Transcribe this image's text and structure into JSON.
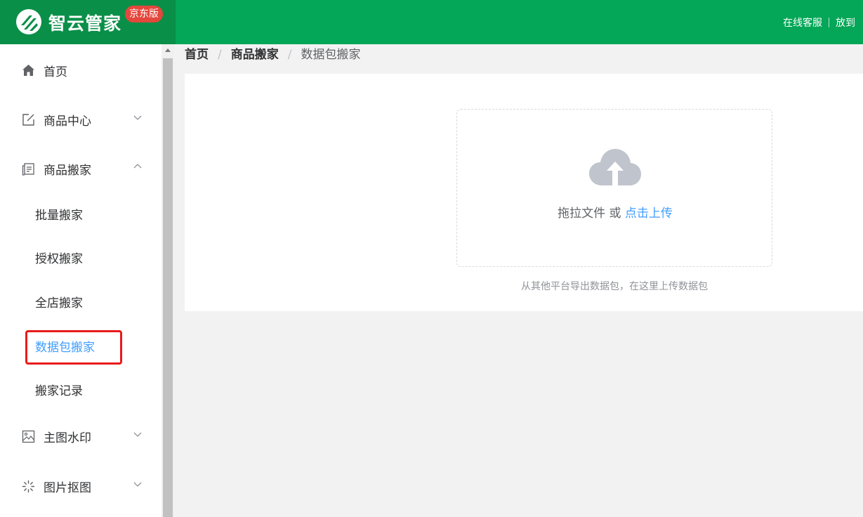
{
  "header": {
    "brand_name": "智云管家",
    "badge": "京东版",
    "links": [
      "在线客服",
      "放到"
    ]
  },
  "sidebar": {
    "items": [
      {
        "label": "首页",
        "icon": "home-icon"
      },
      {
        "label": "商品中心",
        "icon": "edit-icon",
        "expanded": false
      },
      {
        "label": "商品搬家",
        "icon": "document-icon",
        "expanded": true
      },
      {
        "label": "主图水印",
        "icon": "picture-icon",
        "expanded": false
      },
      {
        "label": "图片抠图",
        "icon": "loading-icon",
        "expanded": false
      }
    ],
    "subitems": [
      "批量搬家",
      "授权搬家",
      "全店搬家",
      "数据包搬家",
      "搬家记录"
    ],
    "active_subitem": "数据包搬家"
  },
  "breadcrumb": [
    "首页",
    "商品搬家",
    "数据包搬家"
  ],
  "upload": {
    "text": "拖拉文件 或 ",
    "link": "点击上传",
    "tip": "从其他平台导出数据包，在这里上传数据包"
  },
  "colors": {
    "header_bg": "#04a657",
    "logo_bg": "#0a8f48",
    "badge_bg": "#e4473c",
    "active": "#409eff",
    "highlight": "#e81b1b"
  }
}
